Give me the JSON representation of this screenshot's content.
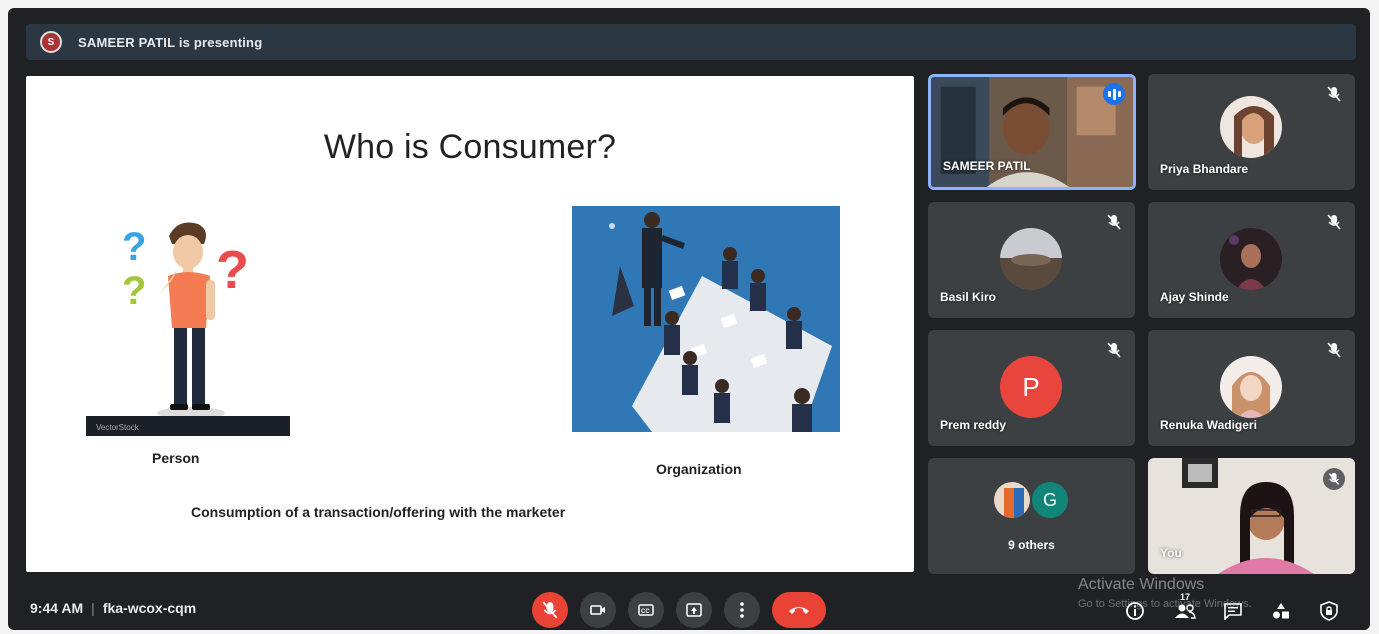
{
  "presenting": {
    "text": "SAMEER PATIL is presenting",
    "avatar_initial": "S"
  },
  "slide": {
    "title": "Who is Consumer?",
    "person_label": "Person",
    "organization_label": "Organization",
    "caption": "Consumption of a transaction/offering with the marketer",
    "stock_tag": "VectorStock"
  },
  "participants": [
    {
      "name": "SAMEER PATIL",
      "type": "video",
      "speaking": true
    },
    {
      "name": "Priya Bhandare",
      "type": "photo",
      "muted": true
    },
    {
      "name": "Basil Kiro",
      "type": "photo",
      "muted": true
    },
    {
      "name": "Ajay Shinde",
      "type": "photo",
      "muted": true
    },
    {
      "name": "Prem reddy",
      "type": "letter",
      "initial": "P",
      "muted": true
    },
    {
      "name": "Renuka Wadigeri",
      "type": "photo",
      "muted": true
    },
    {
      "name": "9 others",
      "type": "group",
      "initial": "G"
    },
    {
      "name": "You",
      "type": "video",
      "muted": true
    }
  ],
  "bottom_bar": {
    "time": "9:44 AM",
    "meeting_code": "fka-wcox-cqm",
    "people_count": "17"
  },
  "watermark": {
    "line1": "Activate Windows",
    "line2": "Go to Settings to activate Windows."
  },
  "icons": {
    "mic_off": "mic-off-icon",
    "camera": "camera-icon",
    "captions": "captions-icon",
    "present": "present-icon",
    "more": "more-icon",
    "end_call": "end-call-icon",
    "info": "info-icon",
    "people": "people-icon",
    "chat": "chat-icon",
    "activities": "activities-icon",
    "host_controls": "lock-icon"
  },
  "colors": {
    "background": "#202124",
    "tile": "#3c4043",
    "accent_blue": "#8ab4f8",
    "danger_red": "#ea4335",
    "present_bar": "#2c3744"
  }
}
